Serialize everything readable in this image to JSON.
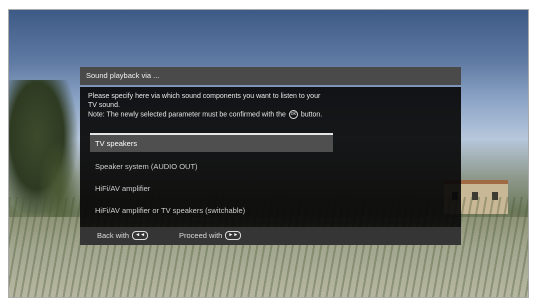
{
  "dialog": {
    "title": "Sound playback via ...",
    "description_line1": "Please specify here via which sound components you want to listen to your",
    "description_line2": "TV sound.",
    "description_line3_pre": "Note: The newly selected parameter must be confirmed with the",
    "ok_glyph": "ok",
    "description_line3_post": "button."
  },
  "options": [
    {
      "label": "TV speakers",
      "selected": true
    },
    {
      "label": "Speaker system (AUDIO OUT)",
      "selected": false
    },
    {
      "label": "HiFi/AV amplifier",
      "selected": false
    },
    {
      "label": "HiFi/AV amplifier or TV speakers (switchable)",
      "selected": false
    }
  ],
  "footer": {
    "back_label": "Back with",
    "back_glyph": "◄◄",
    "proceed_label": "Proceed with",
    "proceed_glyph": "►►"
  },
  "icons": {
    "ok": "ok-button-icon",
    "rewind": "rewind-button-icon",
    "fast_forward": "fast-forward-button-icon"
  }
}
